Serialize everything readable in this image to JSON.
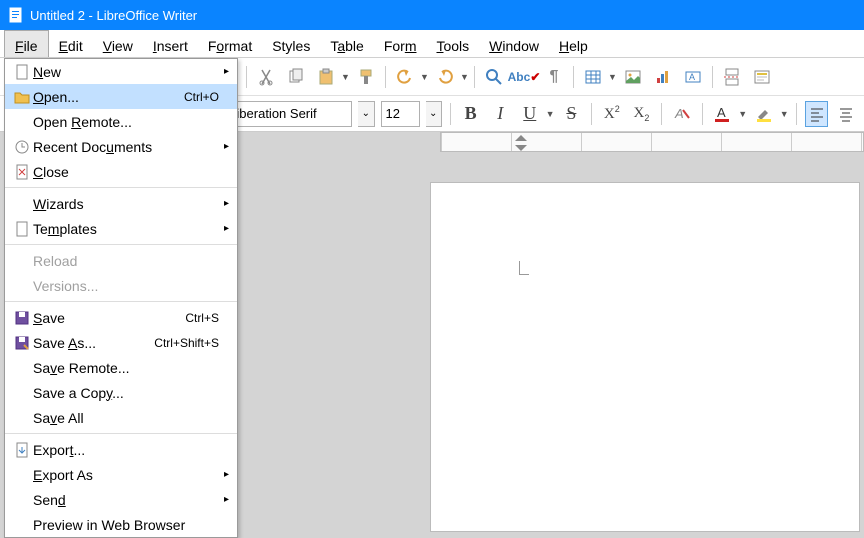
{
  "title_bar": {
    "title": "Untitled 2 - LibreOffice Writer"
  },
  "menu_bar": {
    "file": "File",
    "edit": "Edit",
    "view": "View",
    "insert": "Insert",
    "format": "Format",
    "styles": "Styles",
    "table": "Table",
    "form": "Form",
    "tools": "Tools",
    "window": "Window",
    "help": "Help"
  },
  "file_menu": {
    "new": "New",
    "open": "Open...",
    "open_shortcut": "Ctrl+O",
    "open_remote": "Open Remote...",
    "recent": "Recent Documents",
    "close": "Close",
    "wizards": "Wizards",
    "templates": "Templates",
    "reload": "Reload",
    "versions": "Versions...",
    "save": "Save",
    "save_shortcut": "Ctrl+S",
    "save_as": "Save As...",
    "save_as_shortcut": "Ctrl+Shift+S",
    "save_remote": "Save Remote...",
    "save_copy": "Save a Copy...",
    "save_all": "Save All",
    "export": "Export...",
    "export_as": "Export As",
    "send": "Send",
    "preview": "Preview in Web Browser"
  },
  "toolbar2": {
    "font_name": "Liberation Serif",
    "font_size": "12",
    "bold": "B",
    "italic": "I",
    "underline": "U",
    "strike": "S",
    "super": "X",
    "super_sup": "2",
    "sub": "X",
    "sub_sub": "2"
  },
  "colors": {
    "accent": "#0a84ff",
    "hover": "#c2e0ff"
  }
}
